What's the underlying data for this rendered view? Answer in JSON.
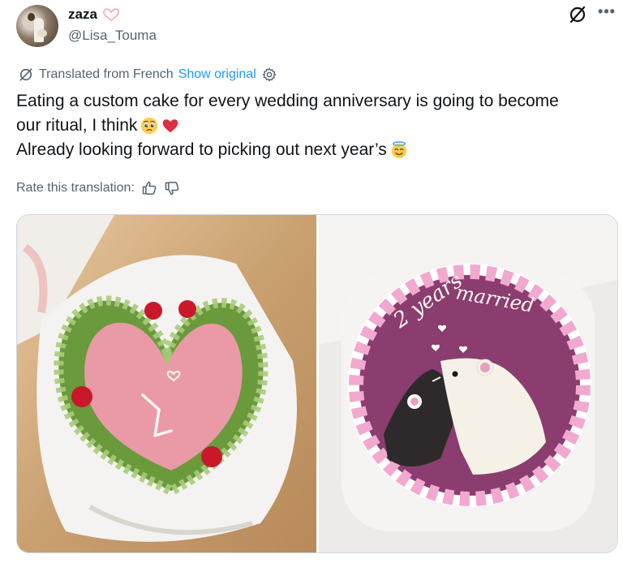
{
  "author": {
    "display_name": "zaza",
    "handle": "@Lisa_Touma",
    "badge_icon": "heart-hands-icon"
  },
  "translation": {
    "label": "Translated from French",
    "show_original": "Show original",
    "settings_icon": "gear-icon",
    "rate_label": "Rate this translation:"
  },
  "tweet": {
    "line1": "Eating a custom cake for every wedding anniversary is going to become",
    "line2": "our ritual, I think",
    "line3": "Already looking forward to picking out next year’s",
    "line2_emojis": [
      "pleading-face-emoji",
      "red-heart-emoji"
    ],
    "line3_emojis": [
      "smiling-face-with-halo-emoji"
    ]
  },
  "media": {
    "photo1": {
      "cake_writing": "1"
    },
    "photo2": {
      "cake_writing": "2 years married"
    }
  },
  "colors": {
    "link": "#1d9bf0",
    "secondary_text": "#536471",
    "heart": "#e0245e",
    "badge_pink": "#f4a6ad"
  }
}
